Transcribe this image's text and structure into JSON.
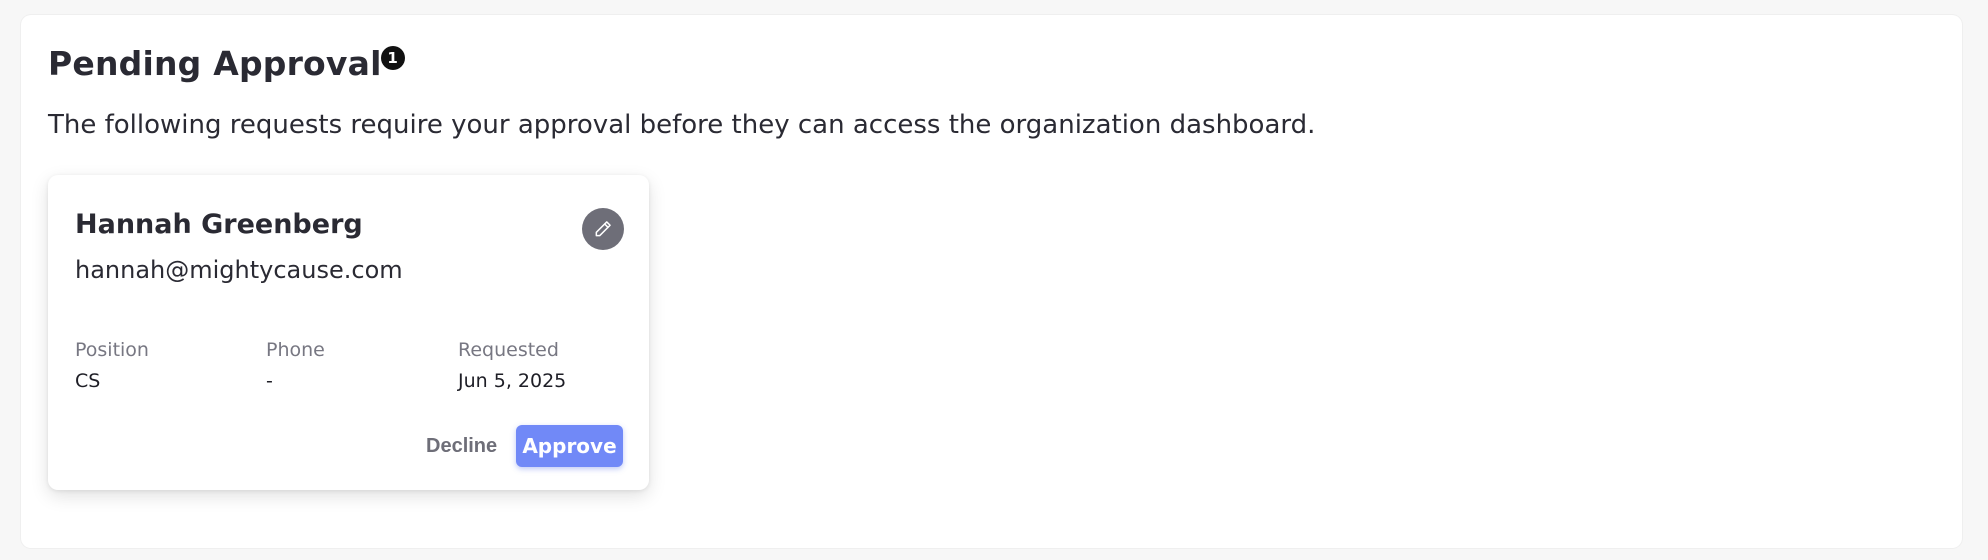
{
  "header": {
    "title": "Pending Approval",
    "count_badge": "1",
    "subtitle": "The following requests require your approval before they can access the organization dashboard."
  },
  "requests": [
    {
      "name": "Hannah Greenberg",
      "email": "hannah@mightycause.com",
      "fields": {
        "position_label": "Position",
        "position_value": "CS",
        "phone_label": "Phone",
        "phone_value": "-",
        "requested_label": "Requested",
        "requested_value": "Jun 5, 2025"
      },
      "actions": {
        "decline_label": "Decline",
        "approve_label": "Approve"
      },
      "edit_icon": "pencil-icon"
    }
  ],
  "colors": {
    "approve_button": "#7189f7",
    "edit_button": "#6e6e78",
    "badge": "#111111"
  }
}
